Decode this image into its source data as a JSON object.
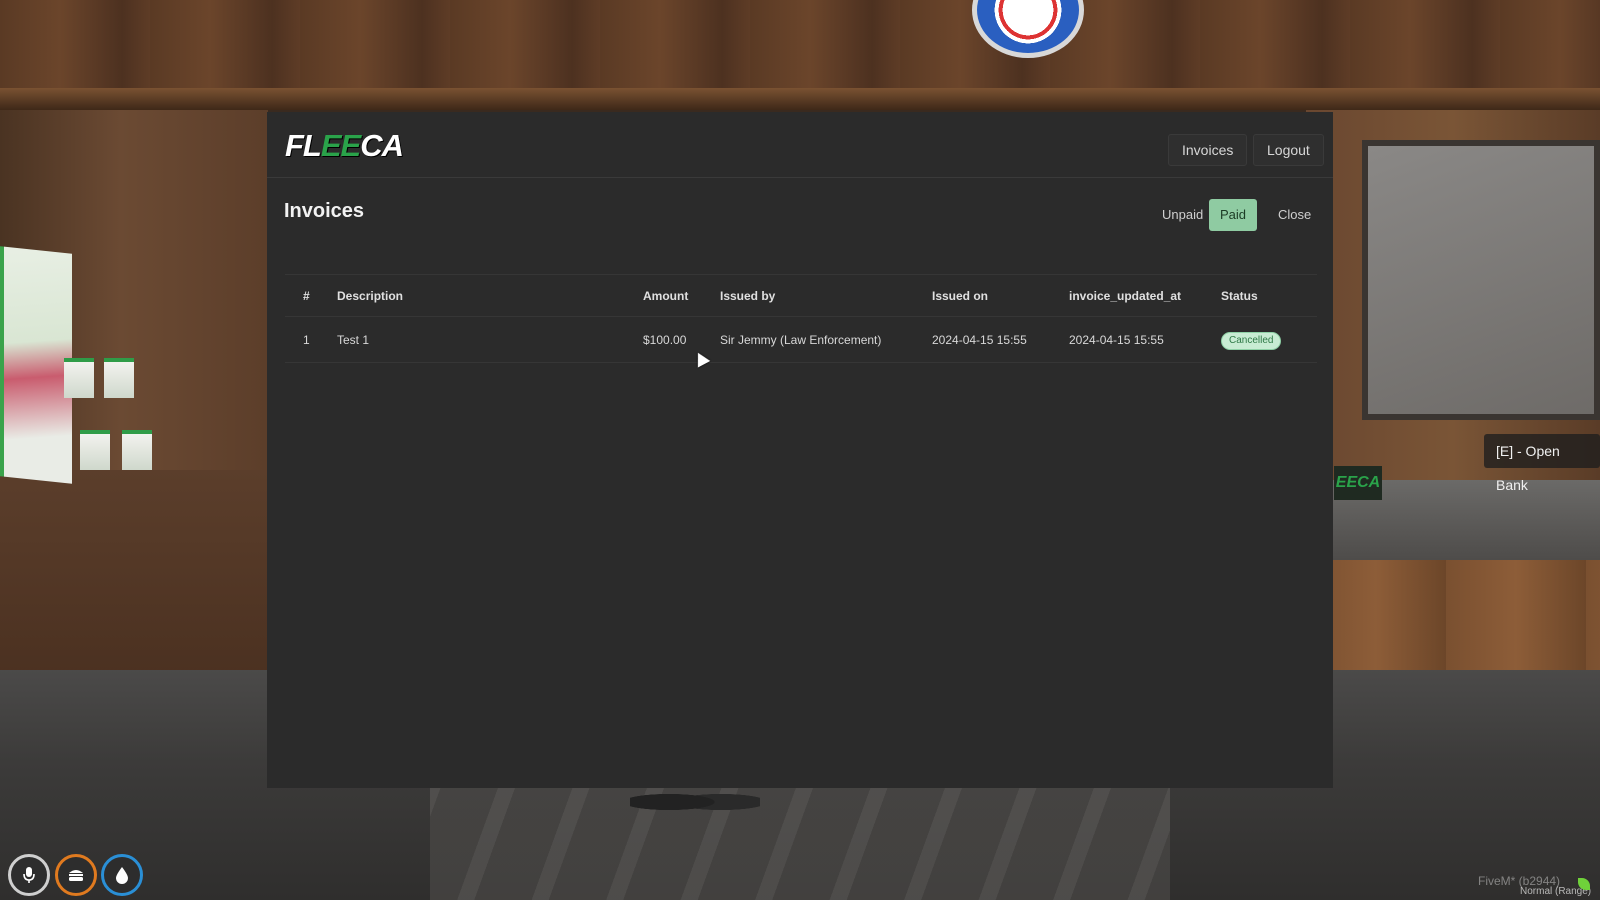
{
  "brand": {
    "prefix": "FL",
    "accent": "EE",
    "suffix": "CA",
    "accent_color": "#2aa34a"
  },
  "nav": {
    "invoices": "Invoices",
    "logout": "Logout"
  },
  "page": {
    "title": "Invoices"
  },
  "filters": {
    "unpaid": "Unpaid",
    "paid": "Paid",
    "active": "Paid",
    "close": "Close"
  },
  "table": {
    "headers": {
      "num": "#",
      "description": "Description",
      "amount": "Amount",
      "issued_by": "Issued by",
      "issued_on": "Issued on",
      "updated": "invoice_updated_at",
      "status": "Status"
    },
    "rows": [
      {
        "num": "1",
        "description": "Test 1",
        "amount": "$100.00",
        "issued_by": "Sir Jemmy (Law Enforcement)",
        "issued_on": "2024-04-15 15:55",
        "updated": "2024-04-15 15:55",
        "status": "Cancelled"
      }
    ]
  },
  "world": {
    "prompt": "[E] - Open Bank",
    "sign": "EECA",
    "watermark": "FiveM* (b2944)",
    "range": "Normal (Range)"
  },
  "hud": {
    "voice_icon": "microphone-icon",
    "food_icon": "food-icon",
    "water_icon": "water-drop-icon"
  },
  "colors": {
    "panel_bg": "#2b2b2b",
    "paid_active": "#8fcba2",
    "status_badge": "#c8ecd3"
  }
}
